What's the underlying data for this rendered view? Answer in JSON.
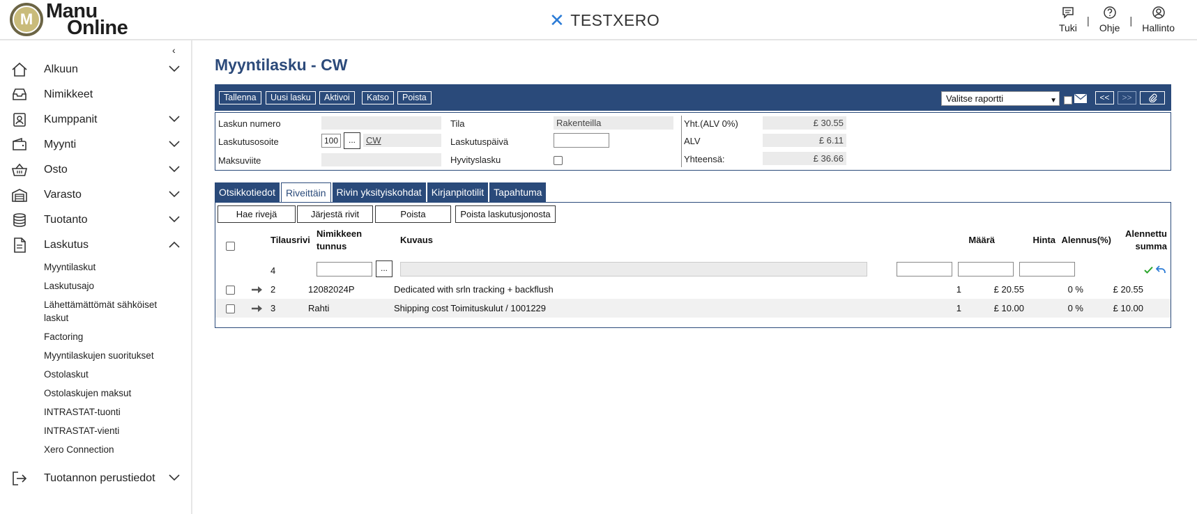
{
  "header": {
    "logo_line1": "Manu",
    "logo_line2": "Online",
    "logo_mark": "M",
    "brand": "TESTXERO",
    "nav": [
      {
        "label": "Tuki",
        "icon": "chat-icon"
      },
      {
        "label": "Ohje",
        "icon": "help-icon"
      },
      {
        "label": "Hallinto",
        "icon": "user-icon"
      }
    ],
    "separator": "|"
  },
  "sidebar": {
    "items": [
      {
        "label": "Alkuun",
        "icon": "home-icon",
        "chevron": "down"
      },
      {
        "label": "Nimikkeet",
        "icon": "inbox-icon",
        "chevron": "none"
      },
      {
        "label": "Kumppanit",
        "icon": "contacts-icon",
        "chevron": "down"
      },
      {
        "label": "Myynti",
        "icon": "wallet-icon",
        "chevron": "down"
      },
      {
        "label": "Osto",
        "icon": "basket-icon",
        "chevron": "down"
      },
      {
        "label": "Varasto",
        "icon": "warehouse-icon",
        "chevron": "down"
      },
      {
        "label": "Tuotanto",
        "icon": "database-icon",
        "chevron": "down"
      },
      {
        "label": "Laskutus",
        "icon": "document-icon",
        "chevron": "up"
      }
    ],
    "subitems": [
      "Myyntilaskut",
      "Laskutusajo",
      "Lähettämättömät sähköiset laskut",
      "Factoring",
      "Myyntilaskujen suoritukset",
      "Ostolaskut",
      "Ostolaskujen maksut",
      "INTRASTAT-tuonti",
      "INTRASTAT-vienti",
      "Xero Connection"
    ],
    "last_item": {
      "label": "Tuotannon perustiedot",
      "icon": "exit-icon",
      "chevron": "down"
    },
    "collapse_glyph": "‹"
  },
  "page": {
    "title": "Myyntilasku - CW",
    "toolbar": {
      "buttons": [
        "Tallenna",
        "Uusi lasku",
        "Aktivoi",
        "Katso",
        "Poista"
      ],
      "report_select": "Valitse raportti",
      "prev": "<<",
      "next": ">>"
    },
    "info": {
      "invoice_number_label": "Laskun numero",
      "invoice_number": "",
      "billing_address_label": "Laskutusosoite",
      "billing_address_code": "100",
      "billing_address_name": "CW",
      "payment_ref_label": "Maksuviite",
      "payment_ref": "",
      "status_label": "Tila",
      "status": "Rakenteilla",
      "invoice_date_label": "Laskutuspäivä",
      "invoice_date": "",
      "credit_note_label": "Hyvityslasku",
      "subtotal_label": "Yht.(ALV 0%)",
      "subtotal": "£ 30.55",
      "vat_label": "ALV",
      "vat": "£ 6.11",
      "total_label": "Yhteensä:",
      "total": "£ 36.66",
      "ellipsis": "..."
    },
    "tabs": [
      "Otsikkotiedot",
      "Riveittäin",
      "Rivin yksityiskohdat",
      "Kirjanpitotilit",
      "Tapahtuma"
    ],
    "active_tab": 1,
    "rows_panel": {
      "buttons": [
        "Hae rivejä",
        "Järjestä rivit",
        "Poista",
        "Poista laskutusjonosta"
      ],
      "columns": {
        "order_row": "Tilausrivi",
        "item_code_1": "Nimikkeen",
        "item_code_2": "tunnus",
        "description": "Kuvaus",
        "quantity": "Määrä",
        "price": "Hinta",
        "discount": "Alennus(%)",
        "discounted_1": "Alennettu",
        "discounted_2": "summa"
      },
      "new_row_number": "4",
      "rows": [
        {
          "order_row": "2",
          "item_code": "12082024P",
          "description": "Dedicated with srln tracking + backflush",
          "quantity": "1",
          "price": "£ 20.55",
          "discount": "0 %",
          "discounted": "£ 20.55"
        },
        {
          "order_row": "3",
          "item_code": "Rahti",
          "description": "Shipping cost Toimituskulut / 1001229",
          "quantity": "1",
          "price": "£ 10.00",
          "discount": "0 %",
          "discounted": "£ 10.00"
        }
      ]
    }
  },
  "colors": {
    "accent": "#2a4a7a",
    "brand_x": "#2b7bd6",
    "confirm": "#2aa52a",
    "undo": "#2b7bd6"
  }
}
